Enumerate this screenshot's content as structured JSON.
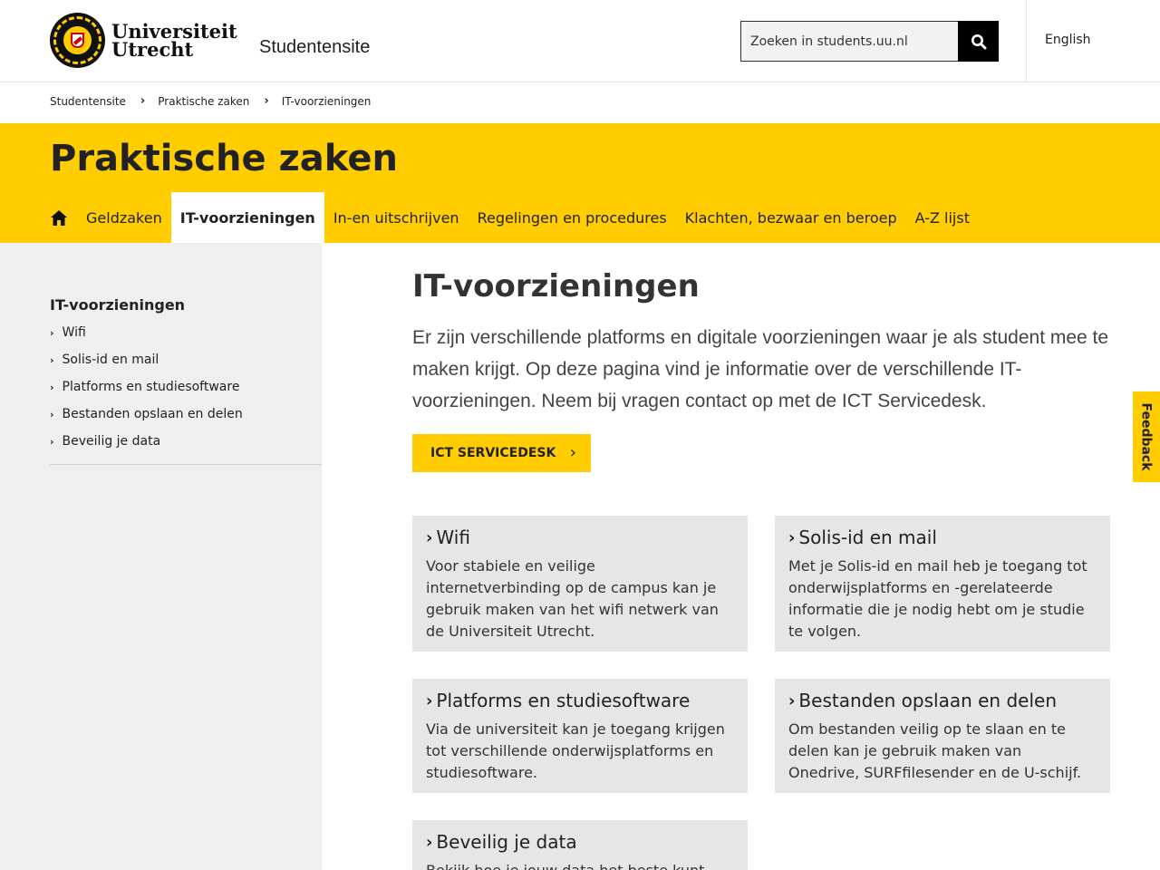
{
  "header": {
    "logo_line1": "Universiteit",
    "logo_line2": "Utrecht",
    "site_name": "Studentensite",
    "search_placeholder": "Zoeken in students.uu.nl",
    "language": "English"
  },
  "breadcrumb": [
    "Studentensite",
    "Praktische zaken",
    "IT-voorzieningen"
  ],
  "section": {
    "title": "Praktische zaken",
    "nav": [
      {
        "label": "Geldzaken"
      },
      {
        "label": "IT-voorzieningen",
        "active": true
      },
      {
        "label": "In-en uitschrijven"
      },
      {
        "label": "Regelingen en procedures"
      },
      {
        "label": "Klachten, bezwaar en beroep"
      },
      {
        "label": "A-Z lijst"
      }
    ]
  },
  "sidebar": {
    "title": "IT-voorzieningen",
    "items": [
      "Wifi",
      "Solis-id en mail",
      "Platforms en studiesoftware",
      "Bestanden opslaan en delen",
      "Beveilig je data"
    ]
  },
  "main": {
    "title": "IT-voorzieningen",
    "intro": "Er zijn verschillende platforms en digitale voorzieningen waar je als student mee te maken krijgt. Op deze pagina vind je informatie over de verschillende IT-voorzieningen. Neem bij vragen contact op met de ICT Servicedesk.",
    "cta": "ICT SERVICEDESK",
    "cards": [
      {
        "title": "Wifi",
        "text": "Voor stabiele en veilige internetverbinding op de campus kan je gebruik maken van het wifi netwerk van de Universiteit Utrecht."
      },
      {
        "title": "Solis-id en mail",
        "text": "Met je Solis-id en mail heb je toegang tot onderwijsplatforms en -gerelateerde informatie die je nodig hebt om je studie te volgen."
      },
      {
        "title": "Platforms en studiesoftware",
        "text": "Via de universiteit kan je toegang krijgen tot verschillende onderwijsplatforms en studiesoftware."
      },
      {
        "title": "Bestanden opslaan en delen",
        "text": "Om bestanden veilig op te slaan en te delen kan je gebruik maken van Onedrive, SURFfilesender en de U-schijf."
      },
      {
        "title": "Beveilig je data",
        "text": "Bekijk hoe je jouw data het beste kunt"
      }
    ]
  },
  "feedback": "Feedback",
  "colors": {
    "accent": "#ffcd00",
    "sidebar_bg": "#efefef",
    "card_bg": "#e6e6e6"
  }
}
